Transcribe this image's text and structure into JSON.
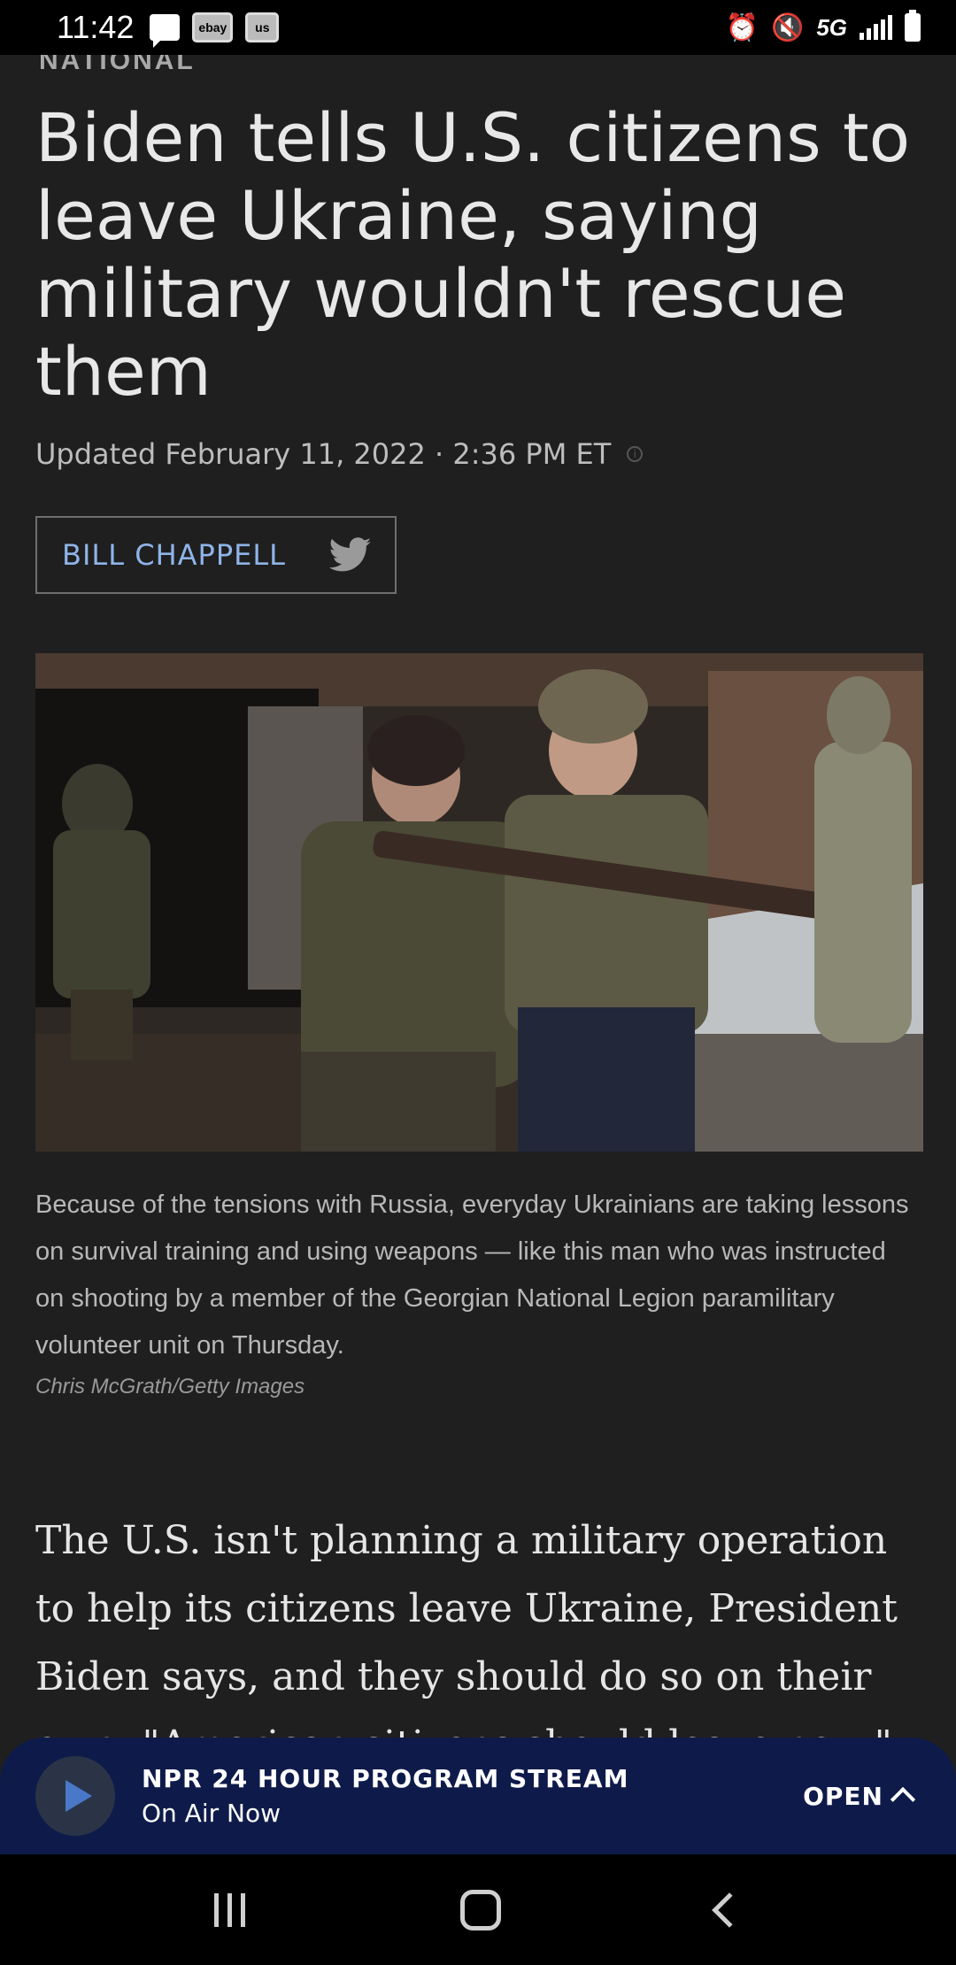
{
  "status_bar": {
    "time": "11:42",
    "left_icons": [
      "message-icon",
      "ebay-app-icon",
      "us-app-icon"
    ],
    "ebay_label": "ebay",
    "us_label": "us",
    "network": "5G",
    "right_icons": [
      "alarm-icon",
      "mute-icon",
      "5g-icon",
      "signal-icon",
      "battery-icon"
    ]
  },
  "article": {
    "section": "NATIONAL",
    "headline": "Biden tells U.S. citizens to leave Ukraine, saying military wouldn't rescue them",
    "updated": "Updated February 11, 2022 · 2:36 PM ET",
    "author": "BILL CHAPPELL",
    "photo_caption": "Because of the tensions with Russia, everyday Ukrainians are taking lessons on survival training and using weapons — like this man who was instructed on shooting by a member of the Georgian National Legion paramilitary volunteer unit on Thursday.",
    "photo_credit": "Chris McGrath/Getty Images",
    "body": "The U.S. isn't planning a military operation to help its citizens leave Ukraine, President Biden says, and they should do so on their own. \"American citizens should leave now,\" Biden"
  },
  "player": {
    "title": "NPR 24 HOUR PROGRAM STREAM",
    "subtitle": "On Air Now",
    "open_label": "OPEN"
  },
  "colors": {
    "background": "#1f1f1f",
    "author_link": "#8fb4e8",
    "player_bg": "#0e1b4a",
    "play_icon": "#4a78c8"
  }
}
